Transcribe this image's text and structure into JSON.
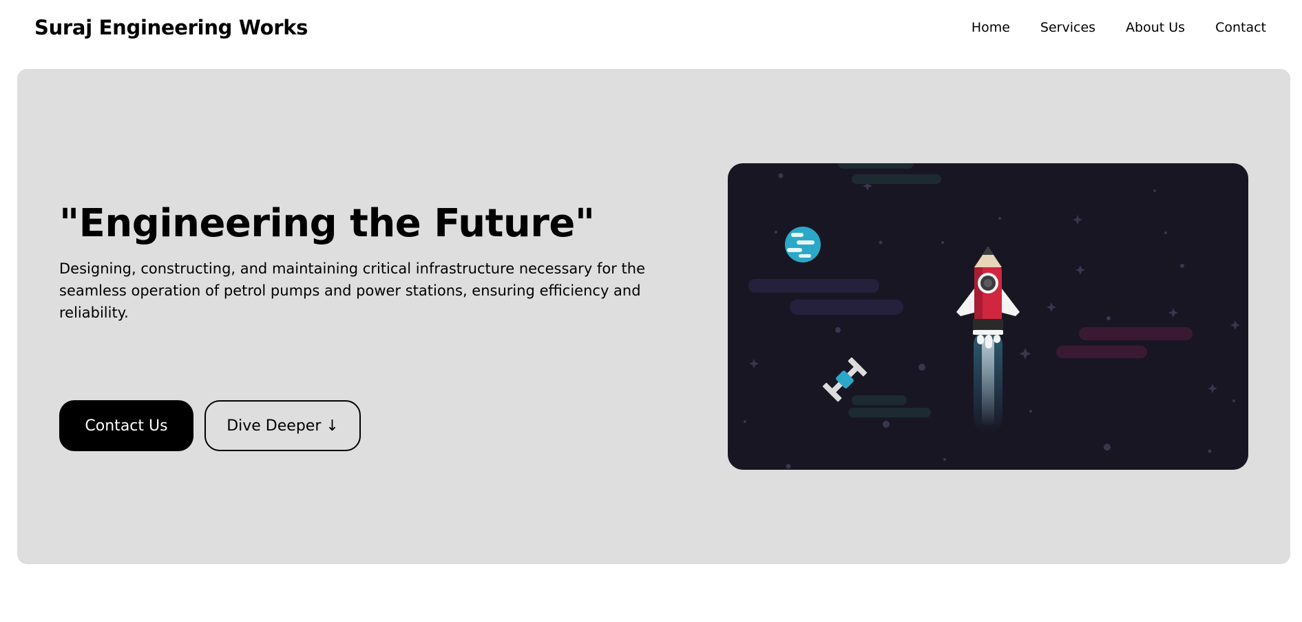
{
  "brand": {
    "name": "Suraj Engineering Works"
  },
  "nav": {
    "items": [
      {
        "label": "Home"
      },
      {
        "label": "Services"
      },
      {
        "label": "About Us"
      },
      {
        "label": "Contact"
      }
    ]
  },
  "hero": {
    "headline": "\"Engineering the Future\"",
    "description": "Designing, constructing, and maintaining critical infrastructure necessary for the seamless operation of petrol pumps and power stations, ensuring efficiency and reliability.",
    "primary_cta": "Contact Us",
    "secondary_cta": "Dive Deeper ↓"
  },
  "illustration": {
    "subject": "rocket-launch-space-scene",
    "colors": {
      "background": "#191624",
      "rocket_body": "#d1263f",
      "planet": "#2ba8c8",
      "satellite_panel": "#2ba8c8"
    }
  },
  "colors": {
    "page_background": "#ffffff",
    "hero_background": "#dedede",
    "primary_button": "#000000",
    "text": "#000000"
  }
}
